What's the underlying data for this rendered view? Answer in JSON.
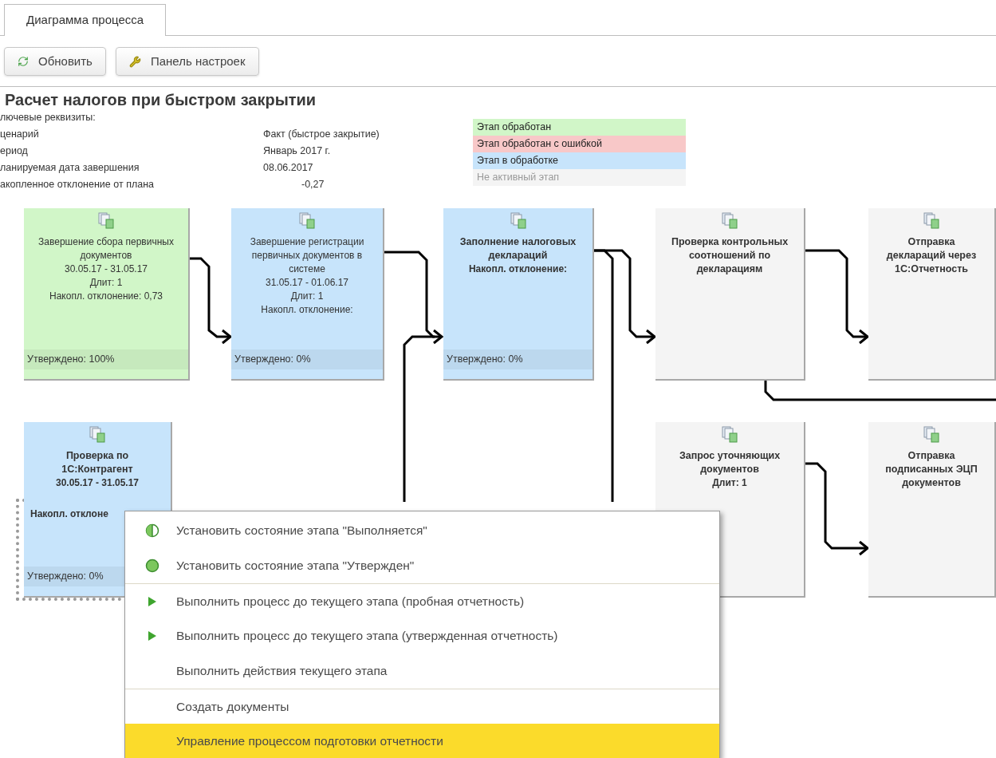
{
  "tabs": [
    {
      "label": "Диаграмма процесса",
      "selected": true
    }
  ],
  "toolbar": [
    "Обновить",
    "Панель настроек"
  ],
  "title": "Расчет налогов при быстром закрытии",
  "key_fields": {
    "heading": "лючевые реквизиты:",
    "rows": [
      {
        "label": "ценарий",
        "value": "Факт (быстрое закрытие)"
      },
      {
        "label": "ериод",
        "value": "Январь 2017 г."
      },
      {
        "label": "ланируемая дата завершения",
        "value": "08.06.2017"
      },
      {
        "label": "акопленное отклонение от плана",
        "value": "-0,27"
      }
    ]
  },
  "legend": [
    {
      "label": "Этап обработан",
      "color": "#d1f6c8",
      "muted": false
    },
    {
      "label": "Этап обработан с ошибкой",
      "color": "#f8c8c8",
      "muted": false
    },
    {
      "label": "Этап в обработке",
      "color": "#c7e4fb",
      "muted": false
    },
    {
      "label": "Не активный этап",
      "color": "#f4f4f4",
      "muted": true
    }
  ],
  "stages": [
    {
      "title": "Завершение сбора первичных документов",
      "bold_title": false,
      "color": "#d1f6c8",
      "lines": [
        "30.05.17 - 31.05.17",
        "Длит: 1",
        "Накопл. отклонение: 0,73"
      ],
      "footer": "Утверждено: 100%",
      "selected": false
    },
    {
      "title": "Завершение регистрации первичных документов в системе",
      "bold_title": false,
      "color": "#c7e4fb",
      "lines": [
        "31.05.17 - 01.06.17",
        "Длит: 1",
        "Накопл. отклонение:"
      ],
      "footer": "Утверждено: 0%",
      "selected": false
    },
    {
      "title": "Заполнение налоговых деклараций",
      "bold_title": true,
      "color": "#c7e4fb",
      "lines": [
        "Накопл. отклонение:"
      ],
      "footer": "Утверждено: 0%",
      "selected": false
    },
    {
      "title": "Проверка контрольных соотношений по декларациям",
      "bold_title": true,
      "color": "#f4f4f4",
      "selected": false
    },
    {
      "title": "Отправка деклараций через 1С:Отчетность",
      "bold_title": true,
      "color": "#f4f4f4",
      "selected": false
    },
    {
      "title": "Проверка по 1С:Контрагент",
      "bold_title": true,
      "color": "#c7e4fb",
      "lines": [
        "30.05.17 - 31.05.17"
      ],
      "cut_lines": [
        "Накопл. отклоне"
      ],
      "footer": "Утверждено: 0%",
      "selected": true
    },
    {
      "title": "Запрос уточняющих документов",
      "bold_title": true,
      "color": "#f4f4f4",
      "lines": [
        "Длит: 1"
      ],
      "selected": false
    },
    {
      "title": "Отправка подписанных ЭЦП документов",
      "bold_title": true,
      "color": "#f4f4f4",
      "selected": false
    }
  ],
  "context_menu": [
    {
      "label": "Установить состояние этапа \"Выполняется\"",
      "kind": "progress",
      "separator_before": false,
      "selected": false
    },
    {
      "label": "Установить состояние этапа \"Утвержден\"",
      "kind": "approve",
      "separator_before": false,
      "selected": false
    },
    {
      "label": "Выполнить процесс до текущего этапа (пробная отчетность)",
      "kind": "run",
      "separator_before": true,
      "selected": false
    },
    {
      "label": "Выполнить процесс до текущего этапа (утвержденная отчетность)",
      "kind": "run",
      "separator_before": false,
      "selected": false
    },
    {
      "label": "Выполнить действия текущего этапа",
      "kind": "plain",
      "separator_before": false,
      "selected": false
    },
    {
      "label": "Создать документы",
      "kind": "plain",
      "separator_before": true,
      "selected": false
    },
    {
      "label": "Управление процессом подготовки отчетности",
      "kind": "plain",
      "separator_before": false,
      "selected": true
    }
  ]
}
